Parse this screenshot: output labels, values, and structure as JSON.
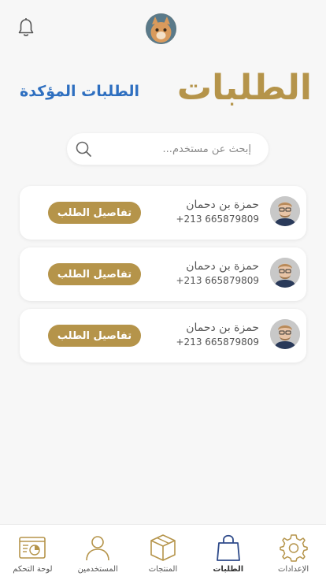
{
  "header": {
    "title": "الطلبات",
    "confirmed_link": "الطلبات المؤكدة"
  },
  "search": {
    "placeholder": "إبحث عن مستخدم...",
    "value": ""
  },
  "orders": [
    {
      "name": "حمزة بن دحمان",
      "phone": "+213 665879809",
      "button": "تفاصيل الطلب"
    },
    {
      "name": "حمزة بن دحمان",
      "phone": "+213 665879809",
      "button": "تفاصيل الطلب"
    },
    {
      "name": "حمزة بن دحمان",
      "phone": "+213 665879809",
      "button": "تفاصيل الطلب"
    }
  ],
  "bottom_nav": {
    "items": [
      {
        "label": "لوحة التحكم",
        "icon": "dashboard-icon"
      },
      {
        "label": "المستخدمين",
        "icon": "user-icon"
      },
      {
        "label": "المنتجات",
        "icon": "box-icon"
      },
      {
        "label": "الطلبات",
        "icon": "shopping-bag-icon",
        "active": true
      },
      {
        "label": "الإعدادات",
        "icon": "gear-icon"
      }
    ]
  },
  "colors": {
    "accent": "#b5944a",
    "link": "#2e6fc0",
    "background": "#f7f7f7"
  }
}
